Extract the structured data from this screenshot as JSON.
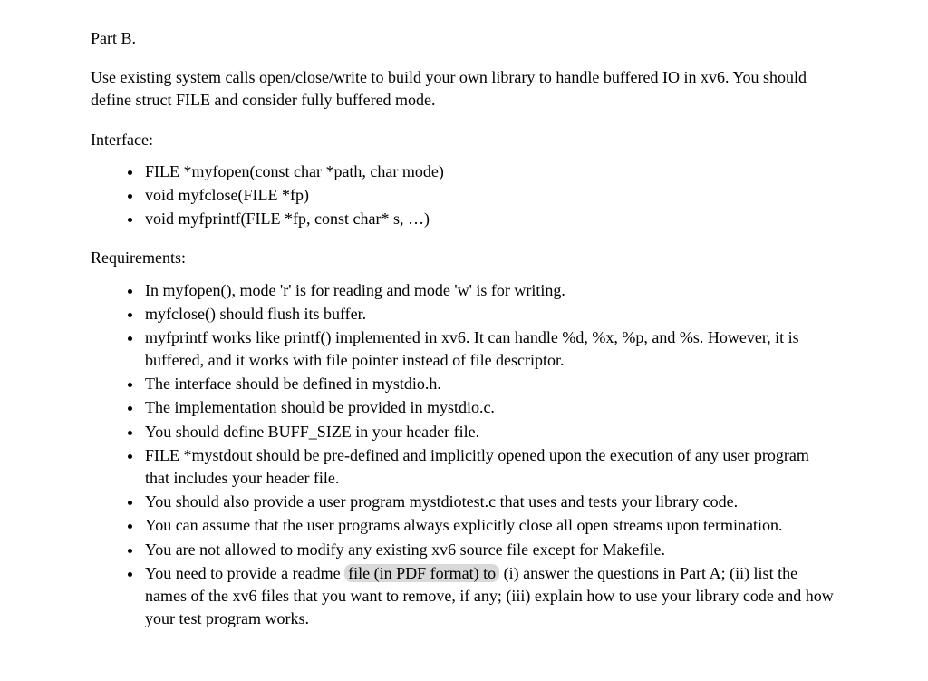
{
  "part_title": "Part B.",
  "intro": "Use existing system calls open/close/write to build your own library to handle buffered IO in xv6. You should define struct FILE and consider fully buffered mode.",
  "interface_label": "Interface:",
  "interface_items": [
    "FILE *myfopen(const char *path, char mode)",
    "void myfclose(FILE *fp)",
    "void myfprintf(FILE *fp, const char* s, …)"
  ],
  "requirements_label": "Requirements:",
  "requirements_items": [
    "In myfopen(), mode 'r' is for reading and mode 'w' is for writing.",
    "myfclose() should flush its buffer.",
    "myfprintf works like printf() implemented in xv6. It can handle %d, %x, %p, and %s. However, it is buffered, and it works with file pointer instead of file descriptor.",
    "The interface should be defined in mystdio.h.",
    "The implementation should be provided in mystdio.c.",
    "You should define BUFF_SIZE in your header file.",
    "FILE *mystdout should be pre-defined and implicitly opened upon the execution of any user program that includes your header file.",
    "You should also provide a user program mystdiotest.c that uses and tests your library code.",
    "You can assume that the user programs always explicitly close all open streams upon termination.",
    "You are not allowed to modify any existing xv6 source file except for Makefile."
  ],
  "final_item_prefix": "You need to provide a readme ",
  "final_item_highlight": "file (in PDF format) to",
  "final_item_suffix": " (i) answer the questions in Part A; (ii) list the names of the xv6 files that you want to remove, if any; (iii) explain how to use your library code and how your test program works."
}
